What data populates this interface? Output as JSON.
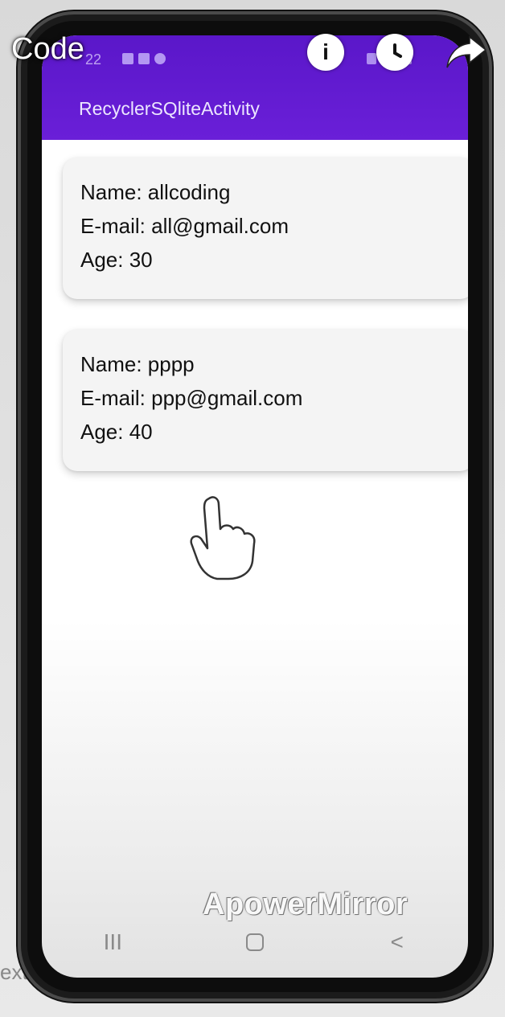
{
  "overlay": {
    "code_label": "Code",
    "info_icon": "info-icon",
    "clock_icon": "clock-icon",
    "share_icon": "share-icon"
  },
  "status_bar": {
    "time": "22"
  },
  "app": {
    "title": "RecyclerSQliteActivity",
    "accent_color": "#6a1fd8"
  },
  "cards": [
    {
      "name": "Name: allcoding",
      "email": "E-mail: all@gmail.com",
      "age": "Age: 30"
    },
    {
      "name": "Name: pppp",
      "email": "E-mail: ppp@gmail.com",
      "age": "Age: 40"
    }
  ],
  "watermark": "ApowerMirror",
  "navbar": {
    "recents": "III",
    "back": "<"
  },
  "background": {
    "left_text_fragment": "ext"
  }
}
